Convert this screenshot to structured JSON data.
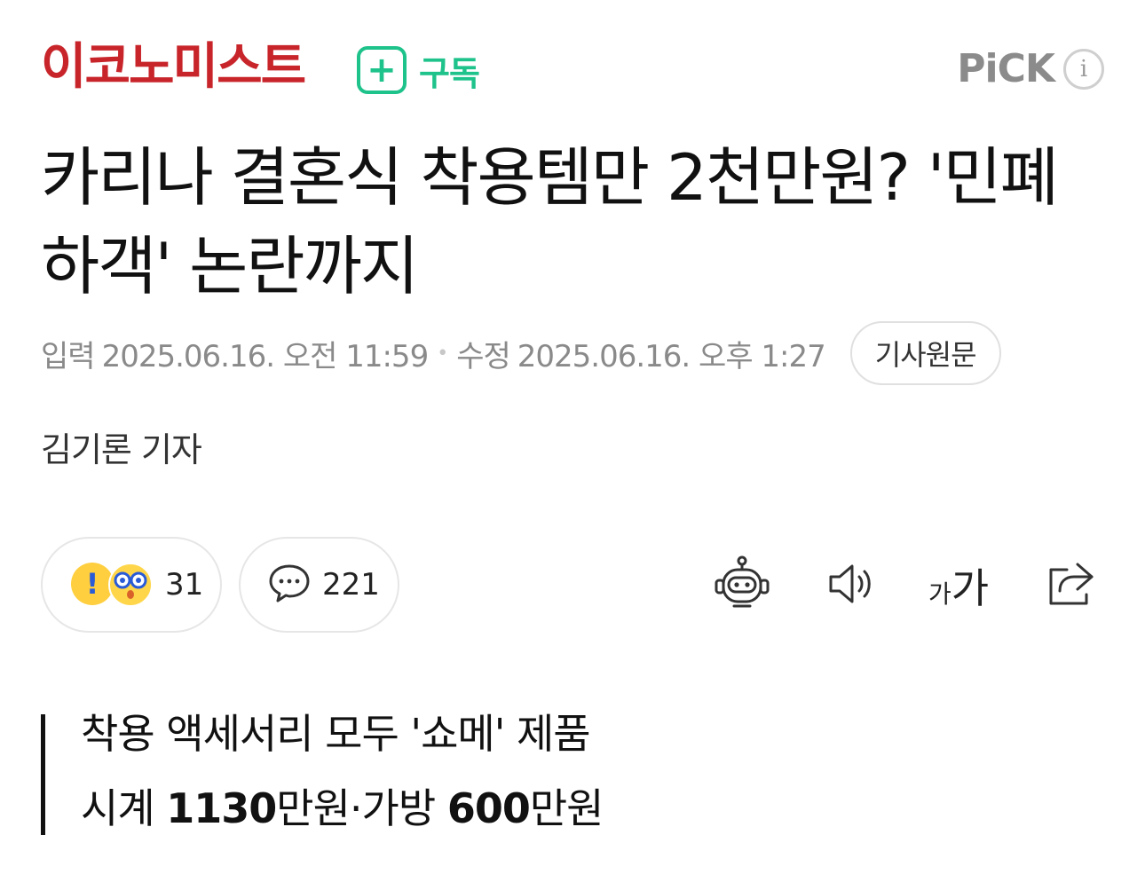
{
  "header": {
    "press_name": "이코노미스트",
    "subscribe_plus": "+",
    "subscribe_label": "구독",
    "pick_label": "PiCK",
    "pick_info_icon": "i"
  },
  "article": {
    "headline": "카리나 결혼식 착용템만 2천만원? '민폐 하객' 논란까지",
    "meta": {
      "input_label": "입력",
      "input_datetime": "2025.06.16. 오전 11:59",
      "separator": "•",
      "modified_label": "수정",
      "modified_datetime": "2025.06.16. 오후 1:27",
      "original_button": "기사원문"
    },
    "reporter": "김기론 기자"
  },
  "reactions": {
    "count": "31",
    "comments": "221"
  },
  "tools": {
    "font_small": "가",
    "font_big": "가"
  },
  "summary": {
    "line1": "착용 액세서리 모두 '쇼메' 제품",
    "line2_prefix": "시계 ",
    "line2_num1": "1130",
    "line2_mid": "만원·가방 ",
    "line2_num2": "600",
    "line2_suffix": "만원"
  },
  "colors": {
    "brand_red": "#c8252b",
    "subscribe_green": "#1ec28b"
  },
  "icons": [
    "subscribe-plus-icon",
    "info-icon",
    "surprise-emoji-icon",
    "comment-icon",
    "robot-icon",
    "speaker-icon",
    "font-size-icon",
    "share-icon"
  ]
}
